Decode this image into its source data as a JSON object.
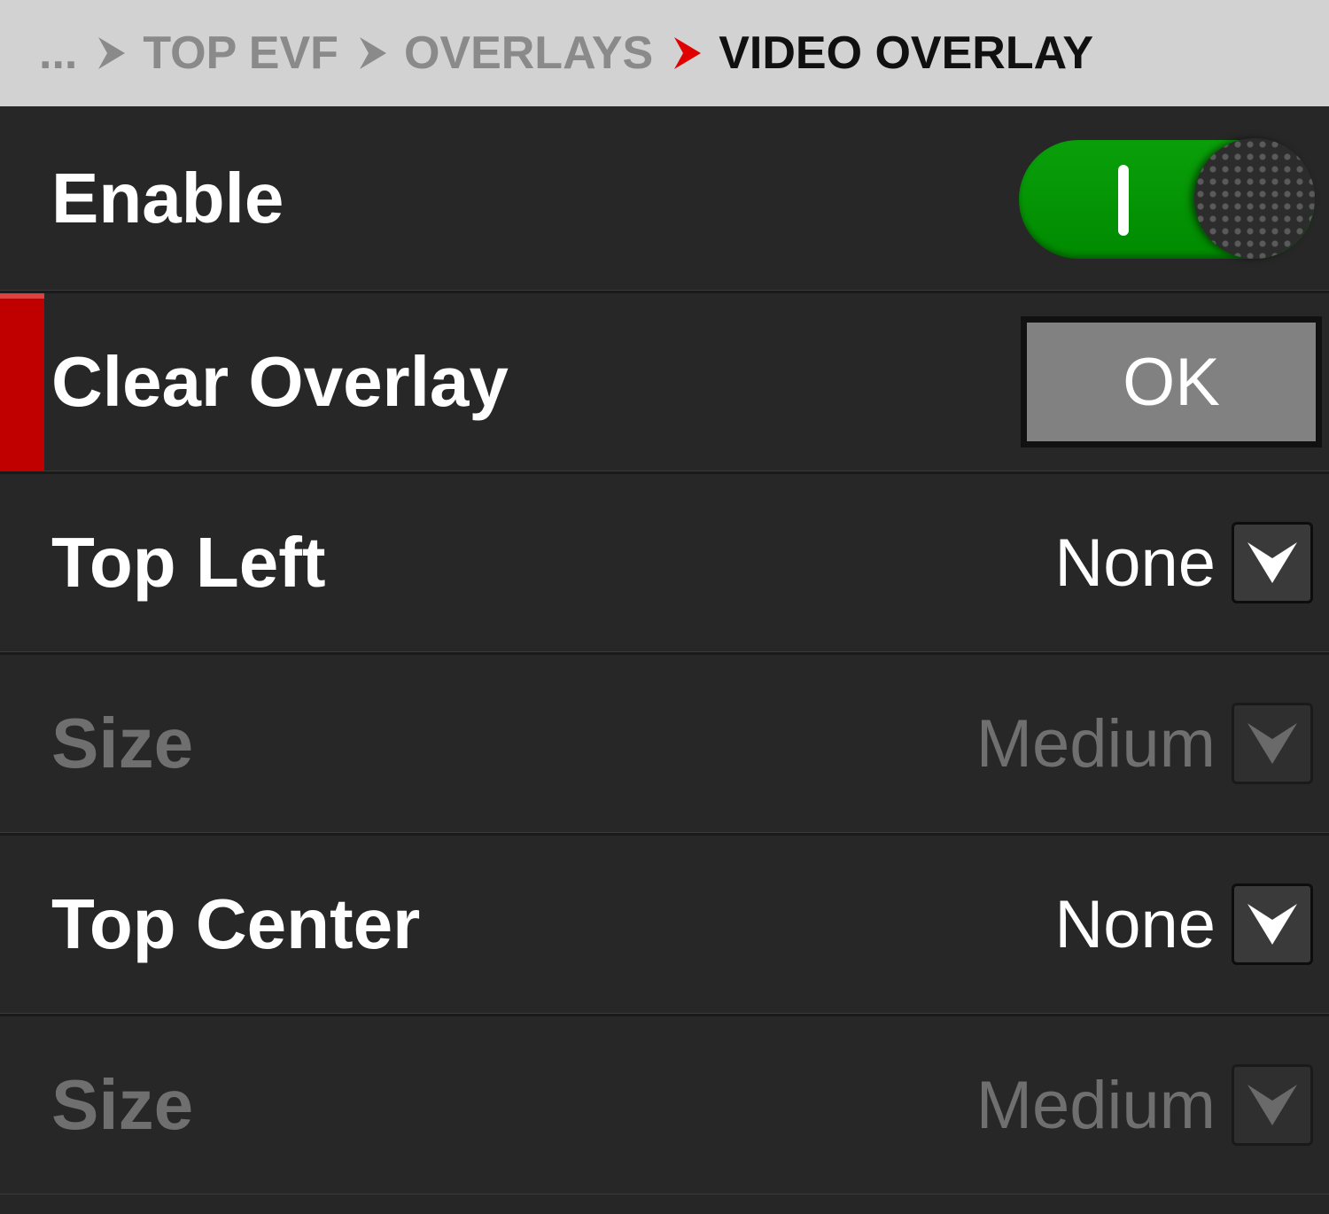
{
  "breadcrumb": {
    "ellipsis": "...",
    "items": [
      "TOP EVF",
      "OVERLAYS",
      "VIDEO OVERLAY"
    ]
  },
  "rows": {
    "enable": {
      "label": "Enable",
      "toggle_on": true
    },
    "clear_overlay": {
      "label": "Clear Overlay",
      "button_label": "OK"
    },
    "top_left": {
      "label": "Top Left",
      "value": "None"
    },
    "top_left_size": {
      "label": "Size",
      "value": "Medium",
      "disabled": true
    },
    "top_center": {
      "label": "Top Center",
      "value": "None"
    },
    "top_center_size": {
      "label": "Size",
      "value": "Medium",
      "disabled": true
    }
  },
  "colors": {
    "accent_red": "#c00000",
    "toggle_green": "#00a000",
    "breadcrumb_bg": "#d2d2d2",
    "panel_bg": "#272727"
  },
  "icons": {
    "separator": "chevron-right-icon",
    "dropdown": "chevron-down-icon"
  }
}
